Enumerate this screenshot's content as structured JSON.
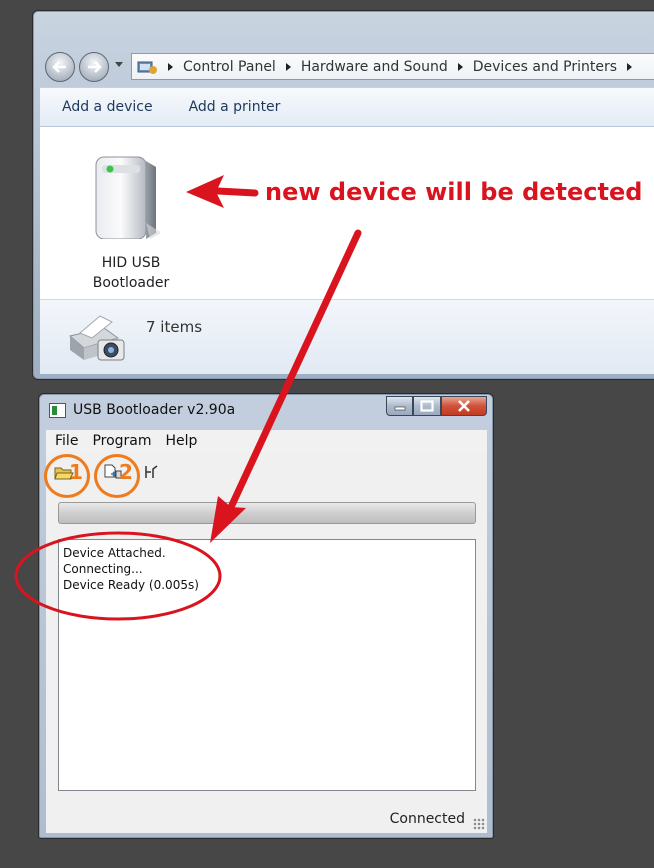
{
  "explorer": {
    "breadcrumb": [
      "Control Panel",
      "Hardware and Sound",
      "Devices and Printers"
    ],
    "commands": {
      "add_device": "Add a device",
      "add_printer": "Add a printer"
    },
    "device": {
      "label_line1": "HID USB",
      "label_line2": "Bootloader"
    },
    "items_count": "7 items"
  },
  "annotation": {
    "text": "new device will be detected",
    "color": "#d9141e"
  },
  "bootloader": {
    "title": "USB Bootloader v2.90a",
    "menu": {
      "file": "File",
      "program": "Program",
      "help": "Help"
    },
    "step1": "1",
    "step2": "2",
    "log": [
      "Device Attached.",
      "Connecting...",
      "Device Ready (0.005s)"
    ],
    "status": "Connected",
    "progress": 0
  },
  "colors": {
    "accent_orange": "#f07b1d",
    "annotation_red": "#d9141e"
  },
  "icons": [
    "back-arrow-icon",
    "forward-arrow-icon",
    "control-panel-icon",
    "hid-device-icon",
    "printer-camera-icon",
    "open-folder-icon",
    "program-device-icon",
    "reset-icon",
    "minimize-icon",
    "maximize-icon",
    "close-icon"
  ]
}
